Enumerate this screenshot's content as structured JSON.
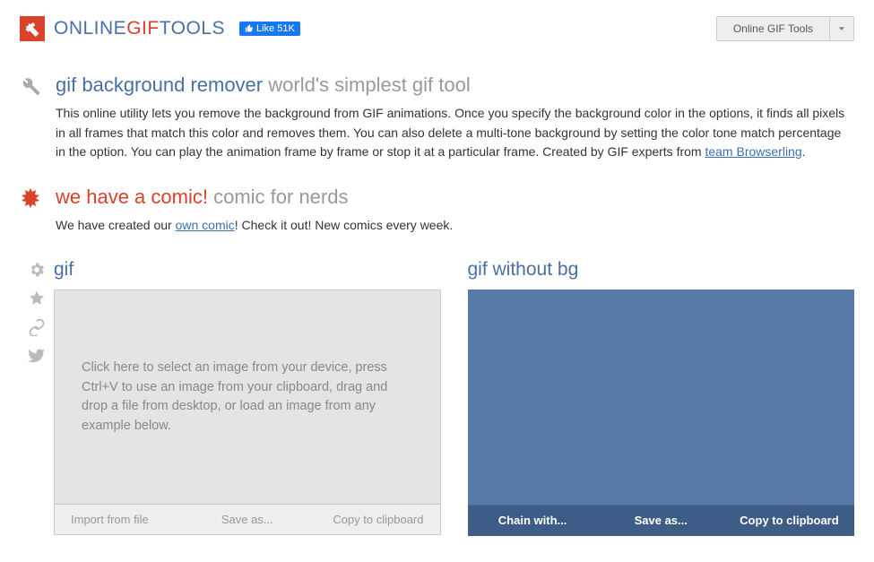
{
  "brand": {
    "p1": "ONLINE",
    "p2": "GIF",
    "p3": "TOOLS"
  },
  "fb_like": "Like 51K",
  "site_dropdown": "Online GIF Tools",
  "tool": {
    "title_main": "gif background remover",
    "title_sub": "world's simplest gif tool",
    "desc_1": "This online utility lets you remove the background from GIF animations. Once you specify the background color in the options, it finds all pixels in all frames that match this color and removes them. You can also delete a multi-tone background by setting the color tone match percentage in the option. You can play the animation frame by frame or stop it at a particular frame. Created by GIF experts from ",
    "desc_link": "team Browserling",
    "desc_2": "."
  },
  "comic": {
    "title_main": "we have a comic!",
    "title_sub": "comic for nerds",
    "text_1": "We have created our ",
    "link": "own comic",
    "text_2": "! Check it out! New comics every week."
  },
  "input_panel": {
    "title": "gif",
    "placeholder": "Click here to select an image from your device, press Ctrl+V to use an image from your clipboard, drag and drop a file from desktop, or load an image from any example below.",
    "actions": {
      "import": "Import from file",
      "save": "Save as...",
      "copy": "Copy to clipboard"
    }
  },
  "output_panel": {
    "title": "gif without bg",
    "actions": {
      "chain": "Chain with...",
      "save": "Save as...",
      "copy": "Copy to clipboard"
    }
  }
}
